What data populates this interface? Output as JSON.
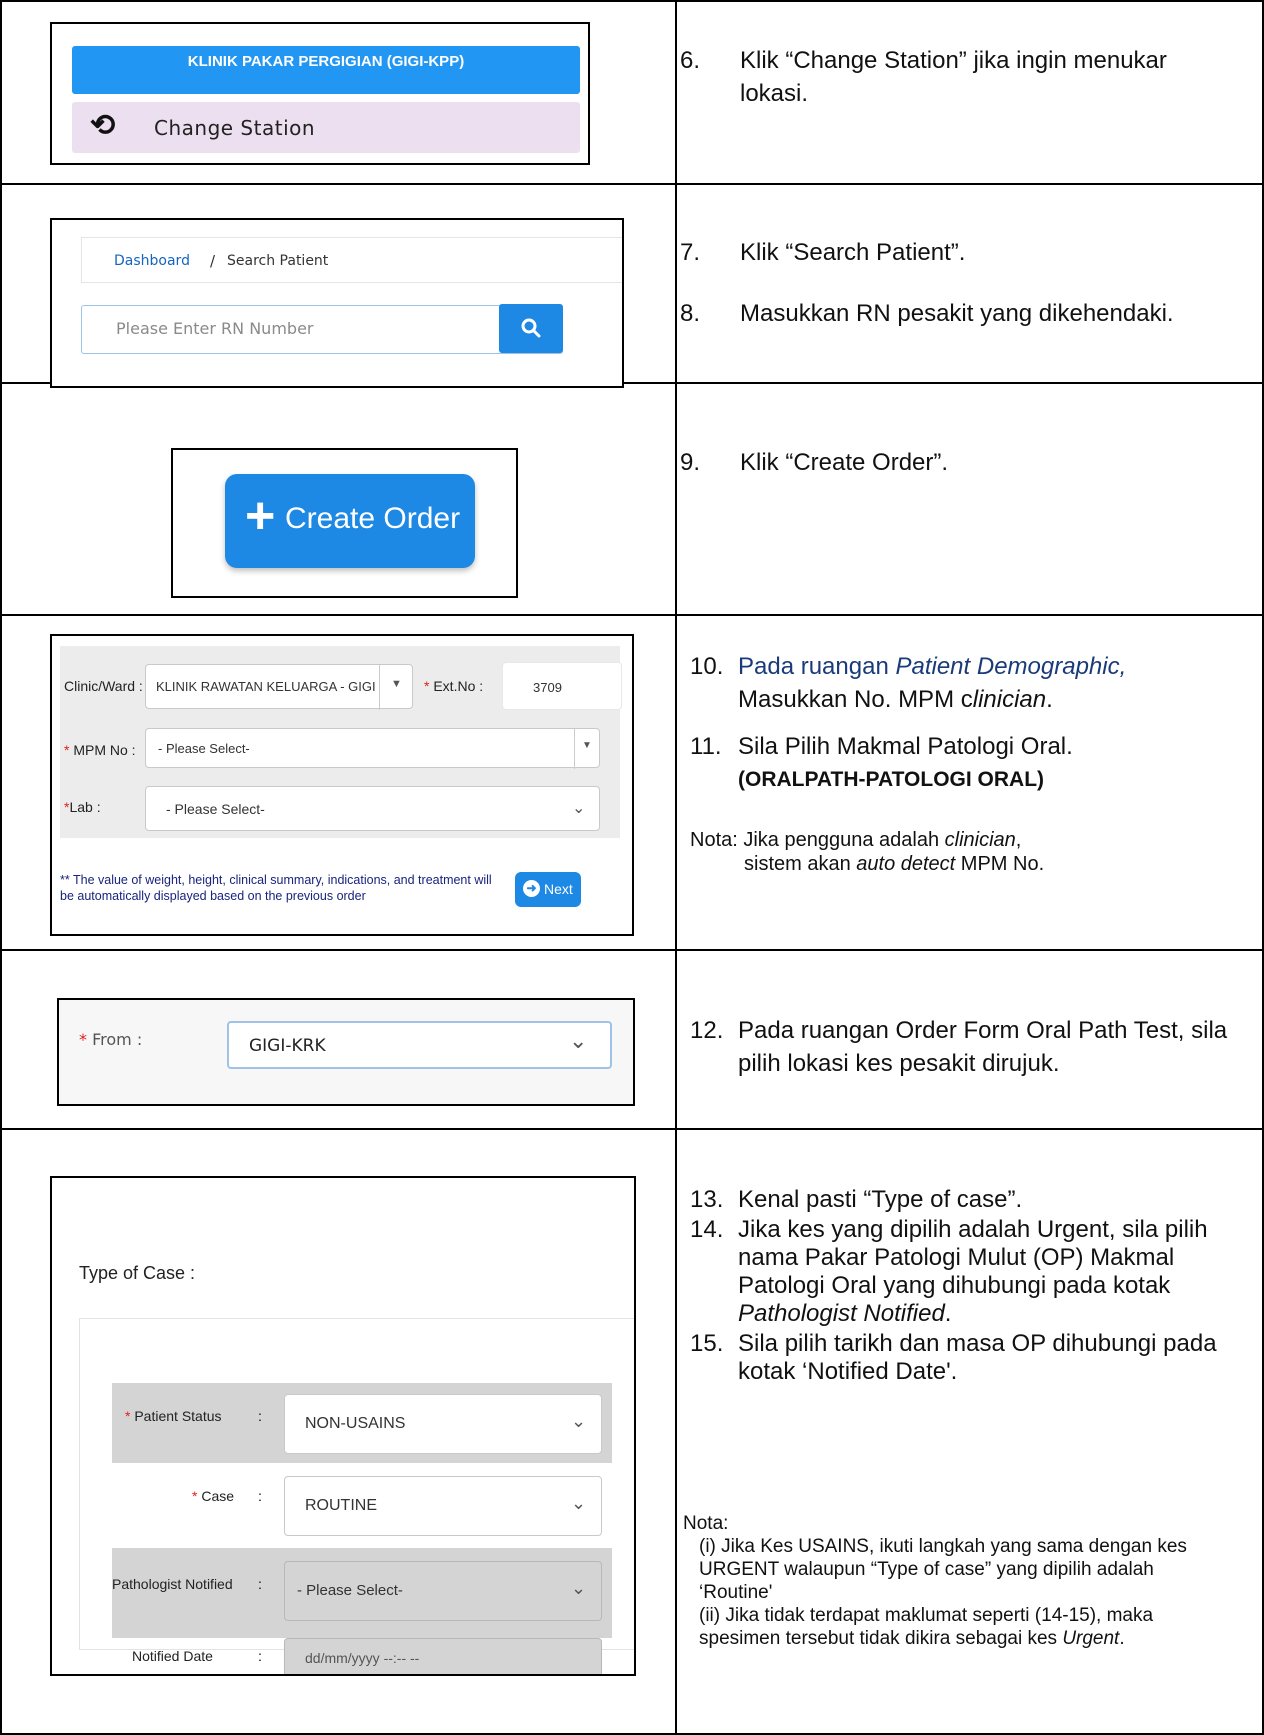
{
  "row1": {
    "station_button": "KLINIK PAKAR PERGIGIAN (GIGI-KPP)",
    "change_station": "Change Station",
    "step_no": "6.",
    "step_text": "Klik “Change Station” jika ingin menukar lokasi."
  },
  "row2": {
    "breadcrumb_dashboard": "Dashboard",
    "breadcrumb_sep": "/",
    "breadcrumb_current": "Search Patient",
    "search_placeholder": "Please Enter RN Number",
    "step7_no": "7.",
    "step7_text": "Klik “Search Patient”.",
    "step8_no": "8.",
    "step8_text": "Masukkan RN pesakit yang dikehendaki."
  },
  "row3": {
    "create_order": "Create Order",
    "step_no": "9.",
    "step_text": "Klik “Create Order”."
  },
  "row4": {
    "clinic_label": "Clinic/Ward :",
    "clinic_value": "KLINIK RAWATAN KELUARGA - GIGI",
    "ext_label": "Ext.No :",
    "ext_value": "3709",
    "mpm_label": "MPM No :",
    "mpm_value": "- Please Select-",
    "lab_label": "Lab :",
    "lab_value": "- Please Select-",
    "info_note": "** The value of weight, height, clinical summary, indications, and treatment will be automatically displayed based on the previous order",
    "next_button": "Next",
    "step10_no": "10.",
    "step10_a": "Pada ruangan ",
    "step10_b": "Patient Demographic,",
    "step10_c": "Masukkan No. MPM c",
    "step10_d": "linician",
    "step10_e": ".",
    "step11_no": "11.",
    "step11_text": "Sila Pilih Makmal Patologi Oral.",
    "step11_bold": "(ORALPATH-PATOLOGI ORAL)",
    "nota_a": "Nota: Jika pengguna adalah ",
    "nota_b": "clinician",
    "nota_c": ",",
    "nota_d": "sistem akan ",
    "nota_e": "auto detect",
    "nota_f": " MPM No."
  },
  "row5": {
    "from_label": "From :",
    "from_value": "GIGI-KRK",
    "step_no": "12.",
    "step_text": "Pada ruangan Order Form Oral Path Test, sila pilih lokasi kes pesakit dirujuk."
  },
  "row6": {
    "type_of_case_label": "Type of Case :",
    "patient_status_label": "Patient Status",
    "patient_status_value": "NON-USAINS",
    "case_label": "Case",
    "case_value": "ROUTINE",
    "pathologist_label": "Pathologist Notified",
    "pathologist_value": "- Please Select-",
    "notified_date_label": "Notified Date",
    "notified_date_value": "dd/mm/yyyy --:-- --",
    "colon": ":",
    "step13_no": "13.",
    "step13_text": "Kenal pasti “Type of case”.",
    "step14_no": "14.",
    "step14_a": "Jika kes yang dipilih adalah Urgent, sila pilih nama Pakar Patologi Mulut (OP) Makmal Patologi Oral yang dihubungi pada kotak ",
    "step14_b": "Pathologist Notified",
    "step14_c": ".",
    "step15_no": "15.",
    "step15_text": "Sila pilih tarikh dan masa OP dihubungi pada kotak ‘Notified Date'.",
    "nota_title": "Nota:",
    "nota_i": "(i) Jika Kes USAINS, ikuti langkah yang sama dengan kes URGENT walaupun “Type of case” yang dipilih adalah ‘Routine'",
    "nota_ii_a": "(ii) Jika tidak terdapat maklumat seperti (14-15), maka spesimen tersebut tidak dikira sebagai kes ",
    "nota_ii_b": "Urgent",
    "nota_ii_c": "."
  },
  "colors": {
    "primary_blue": "#1e88e5",
    "change_station_bg": "#ecdff0",
    "grey_panel": "#ececec"
  }
}
